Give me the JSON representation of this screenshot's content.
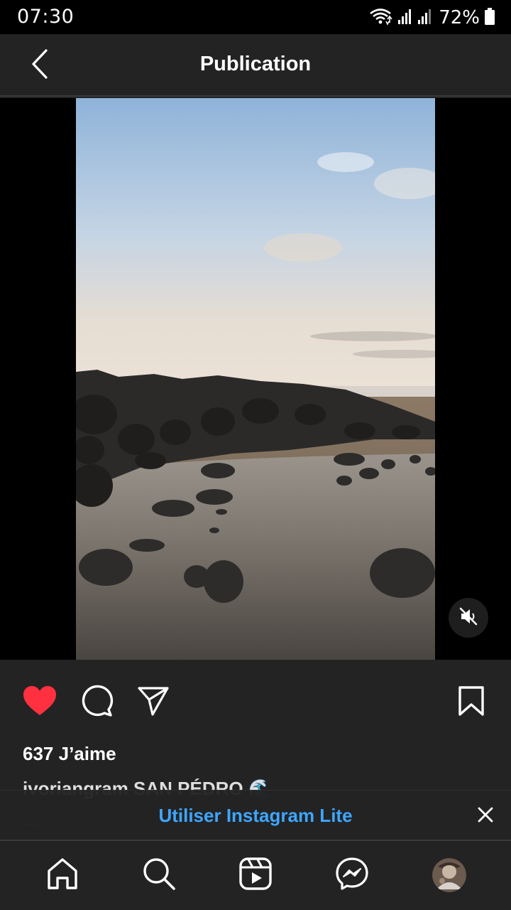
{
  "status_bar": {
    "time": "07:30",
    "battery": "72%",
    "icons": [
      "wifi-icon",
      "signal-icon",
      "signal-icon",
      "battery-icon"
    ]
  },
  "header": {
    "title": "Publication",
    "back_icon": "back-arrow-icon"
  },
  "media": {
    "mute_icon": "volume-muted-icon"
  },
  "actions": {
    "like_icon": "heart-filled-icon",
    "comment_icon": "comment-icon",
    "share_icon": "send-icon",
    "save_icon": "bookmark-icon",
    "like_color": "#ff3040"
  },
  "post": {
    "likes": "637 J’aime",
    "caption": "ivoriangram SAN PÉDRO 🌊",
    "more": "..."
  },
  "banner": {
    "link": "Utiliser Instagram Lite",
    "link_color": "#3ea6ff",
    "close_icon": "close-icon"
  },
  "bottom_nav": {
    "items": [
      "home-icon",
      "search-icon",
      "reels-icon",
      "messenger-icon",
      "profile-avatar"
    ]
  }
}
